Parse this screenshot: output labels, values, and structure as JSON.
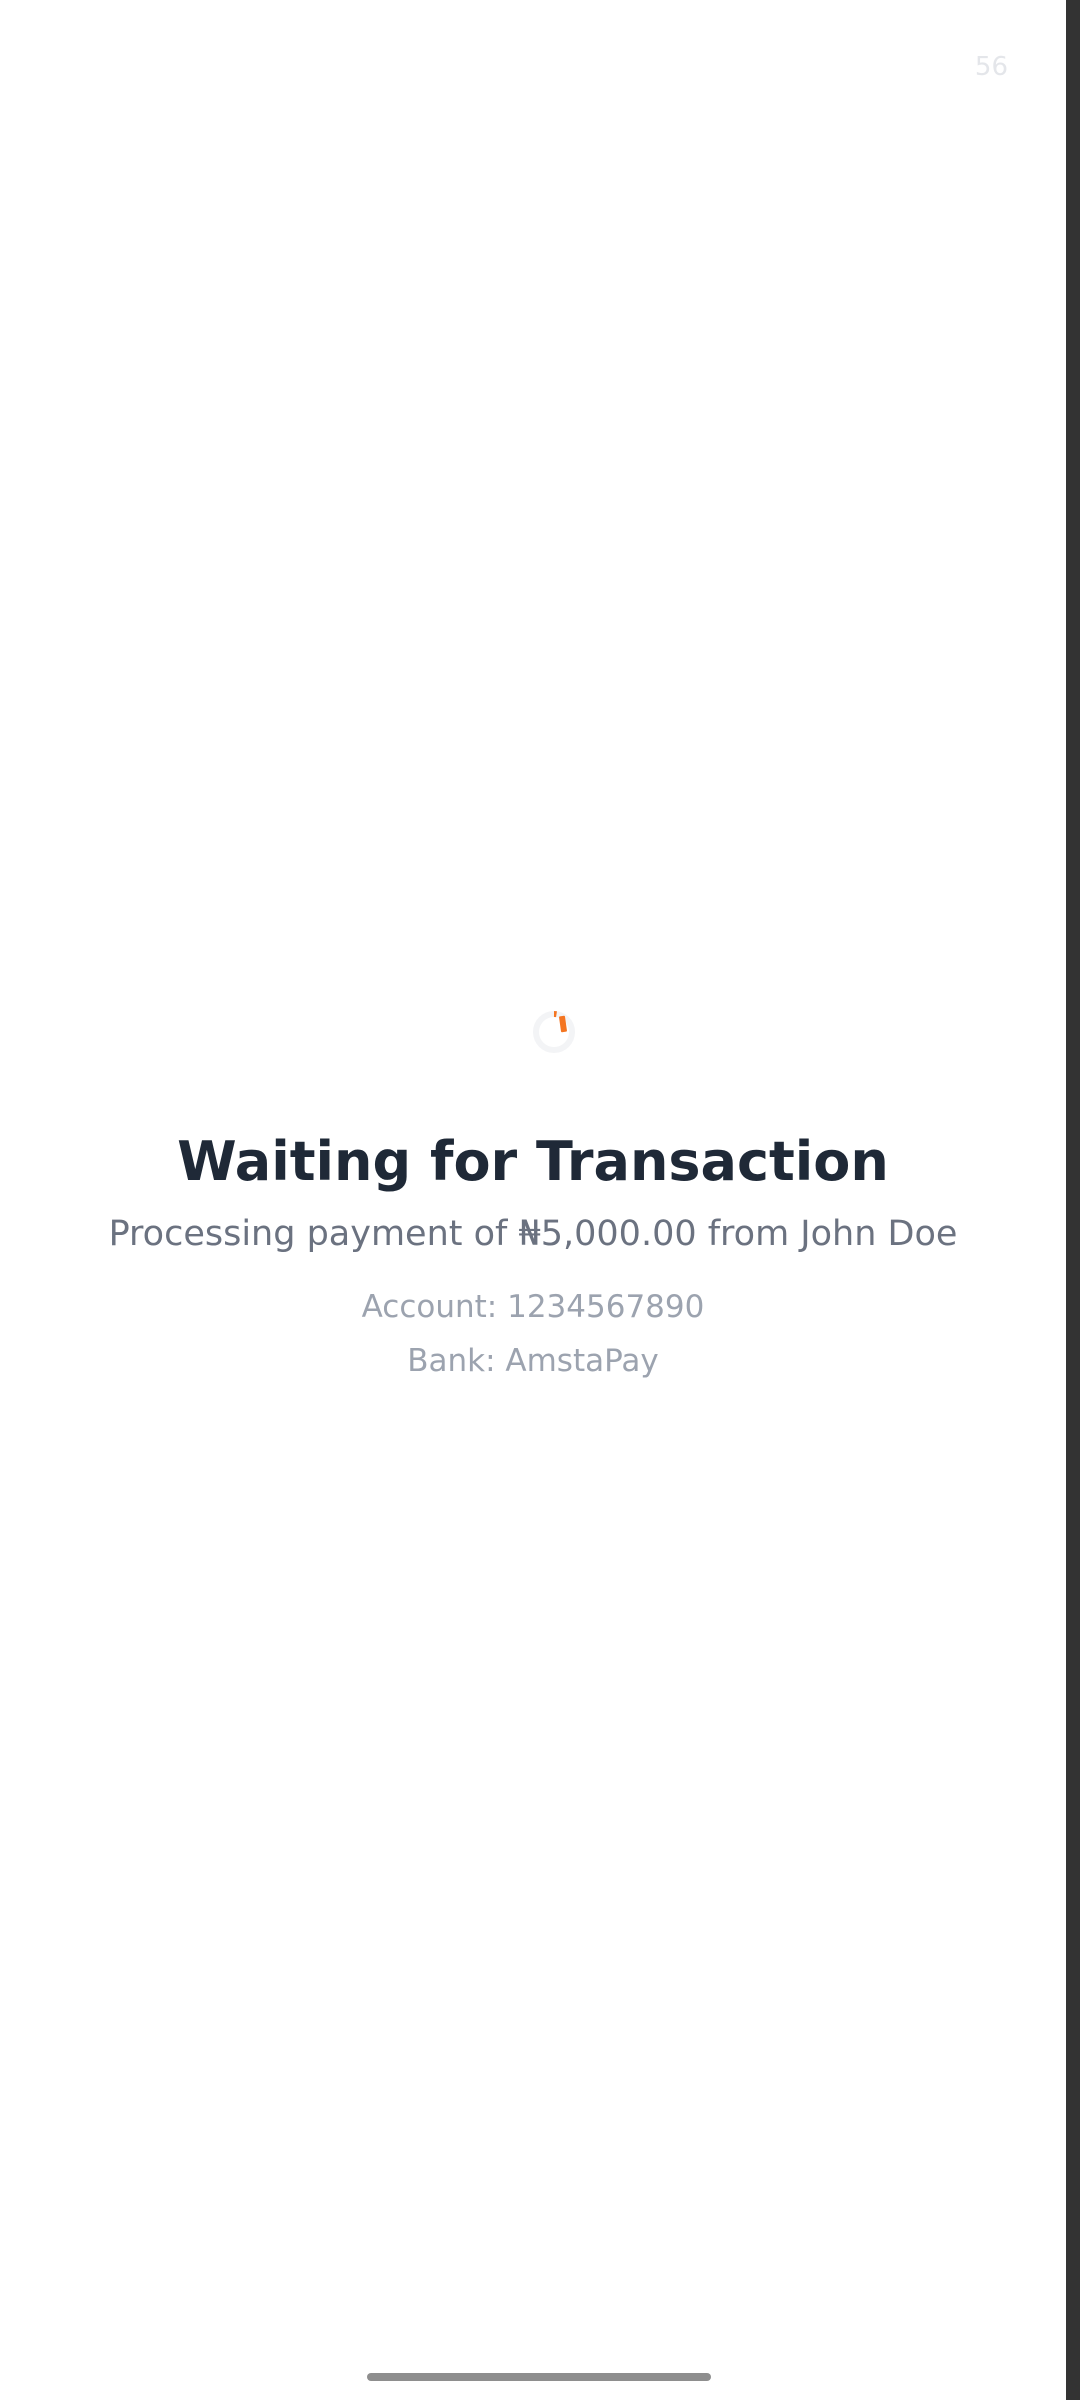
{
  "status_bar": {
    "timer": "56"
  },
  "spinner": {
    "icon": "loading-spinner-icon",
    "color": "#f47521"
  },
  "main": {
    "title": "Waiting for Transaction",
    "subtitle": "Processing payment of ₦5,000.00 from John Doe",
    "account": "Account: 1234567890",
    "bank": "Bank: AmstaPay"
  },
  "colors": {
    "accent": "#f47521",
    "title": "#1f2937",
    "subtitle": "#6b7280",
    "detail": "#9ca3af"
  }
}
